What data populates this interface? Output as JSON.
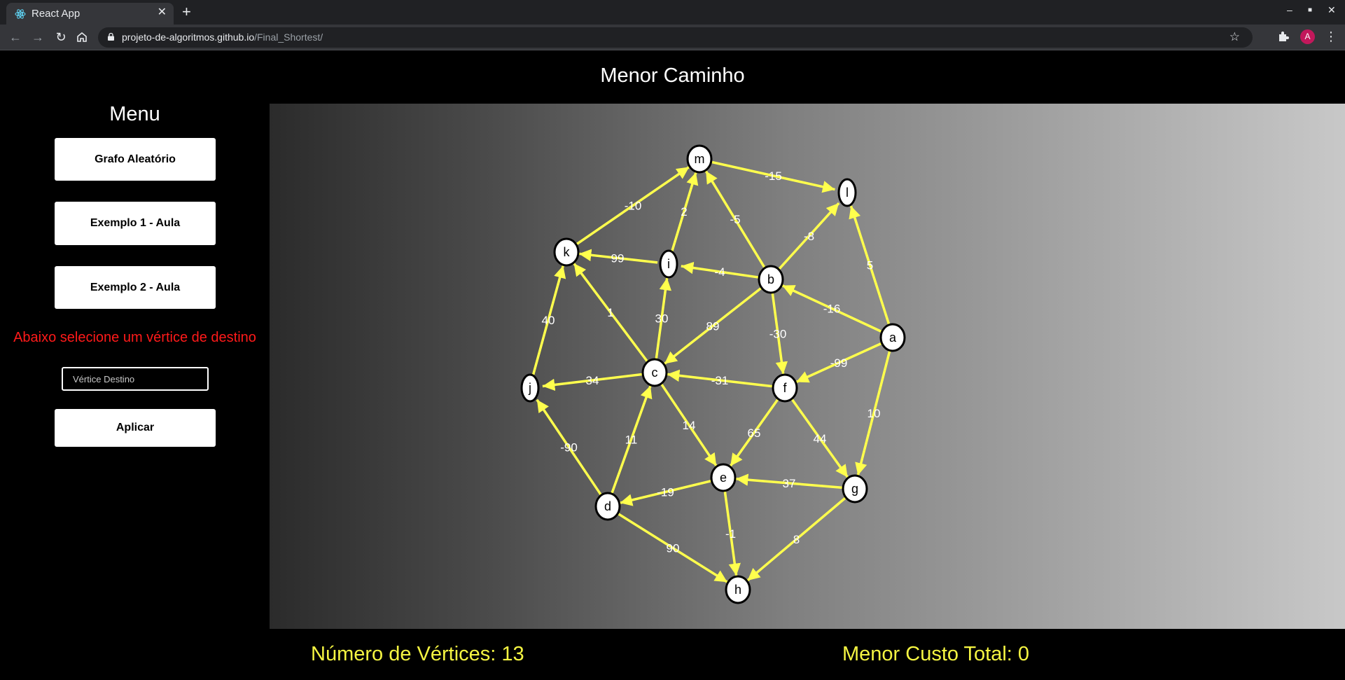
{
  "browser": {
    "tab_title": "React App",
    "url_domain": "projeto-de-algoritmos.github.io",
    "url_path": "/Final_Shortest/",
    "avatar_letter": "A"
  },
  "page": {
    "title": "Menor Caminho"
  },
  "sidebar": {
    "menu_title": "Menu",
    "buttons": [
      "Grafo Aleatório",
      "Exemplo 1 - Aula",
      "Exemplo 2 - Aula"
    ],
    "destination_prompt": "Abaixo selecione um vértice de destino",
    "destination_placeholder": "Vértice Destino",
    "apply_label": "Aplicar"
  },
  "graph": {
    "colors": {
      "edge": "#ffff4d",
      "node_fill": "#ffffff",
      "node_stroke": "#000000",
      "label": "#ffffff"
    },
    "nodes": [
      "a",
      "b",
      "c",
      "d",
      "e",
      "f",
      "g",
      "h",
      "i",
      "j",
      "k",
      "l",
      "m"
    ],
    "edges": [
      {
        "from": "m",
        "to": "l",
        "weight": "-15"
      },
      {
        "from": "k",
        "to": "m",
        "weight": "-10"
      },
      {
        "from": "i",
        "to": "m",
        "weight": "2"
      },
      {
        "from": "b",
        "to": "m",
        "weight": "-5"
      },
      {
        "from": "b",
        "to": "l",
        "weight": "-8"
      },
      {
        "from": "a",
        "to": "l",
        "weight": "5"
      },
      {
        "from": "i",
        "to": "k",
        "weight": "99"
      },
      {
        "from": "b",
        "to": "i",
        "weight": "-4"
      },
      {
        "from": "a",
        "to": "b",
        "weight": "-16"
      },
      {
        "from": "j",
        "to": "k",
        "weight": "40"
      },
      {
        "from": "c",
        "to": "k",
        "weight": "1"
      },
      {
        "from": "c",
        "to": "i",
        "weight": "30"
      },
      {
        "from": "b",
        "to": "c",
        "weight": "89"
      },
      {
        "from": "b",
        "to": "f",
        "weight": "-30"
      },
      {
        "from": "a",
        "to": "f",
        "weight": "-99"
      },
      {
        "from": "c",
        "to": "j",
        "weight": "34"
      },
      {
        "from": "f",
        "to": "c",
        "weight": "-31"
      },
      {
        "from": "a",
        "to": "g",
        "weight": "10"
      },
      {
        "from": "d",
        "to": "j",
        "weight": "-90"
      },
      {
        "from": "d",
        "to": "c",
        "weight": "11"
      },
      {
        "from": "c",
        "to": "e",
        "weight": "14"
      },
      {
        "from": "f",
        "to": "e",
        "weight": "65"
      },
      {
        "from": "f",
        "to": "g",
        "weight": "44"
      },
      {
        "from": "e",
        "to": "d",
        "weight": "-19"
      },
      {
        "from": "g",
        "to": "e",
        "weight": "37"
      },
      {
        "from": "d",
        "to": "h",
        "weight": "90"
      },
      {
        "from": "e",
        "to": "h",
        "weight": "-1"
      },
      {
        "from": "g",
        "to": "h",
        "weight": "8"
      }
    ]
  },
  "footer": {
    "vertices_label": "Número de Vértices: 13",
    "cost_label": "Menor Custo Total: 0"
  }
}
